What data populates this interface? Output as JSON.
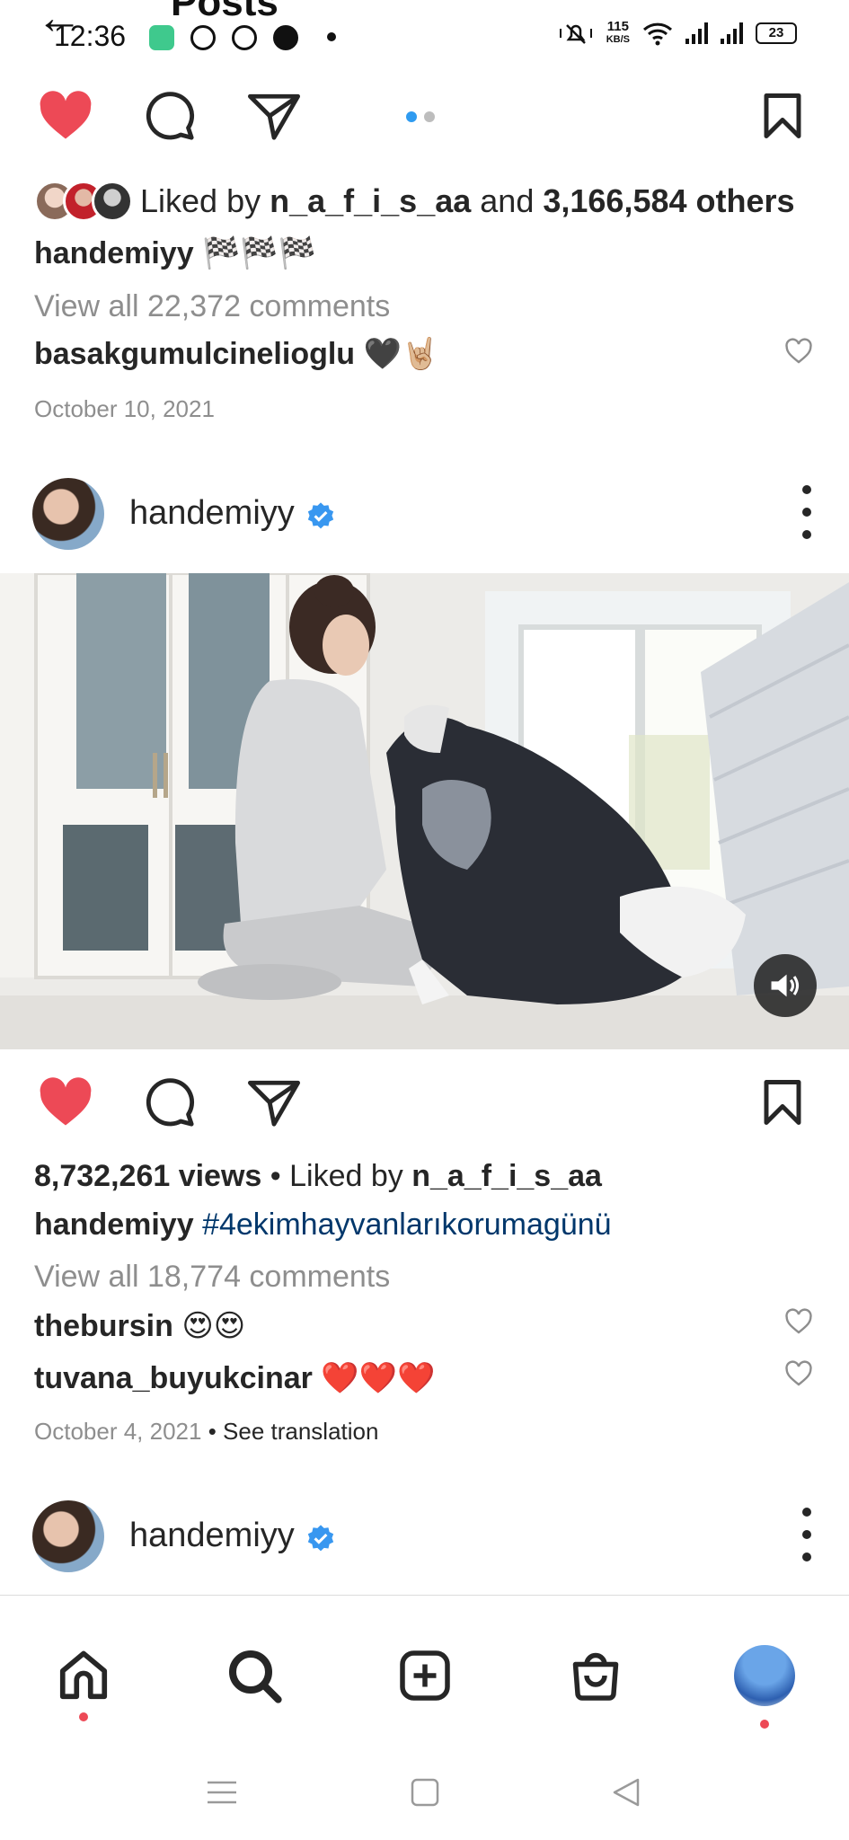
{
  "status_bar": {
    "time": "12:36",
    "network_speed_value": "115",
    "network_speed_unit": "KB/S",
    "battery": "23"
  },
  "header": {
    "back_icon": "arrow-left-icon",
    "title": "Posts"
  },
  "post1": {
    "icons": [
      "heart-filled-icon",
      "comment-icon",
      "share-icon",
      "bookmark-icon"
    ],
    "liked_prefix": "Liked by ",
    "liked_user": "n_a_f_i_s_aa",
    "liked_mid": " and ",
    "liked_count": "3,166,584 others",
    "caption_user": "handemiyy",
    "caption_text": " 🏁🏁🏁",
    "view_comments": "View all 22,372 comments",
    "comment_user": "basakgumulcinelioglu",
    "comment_text": " 🖤🤘🏼",
    "date": "October 10, 2021"
  },
  "post2": {
    "username": "handemiyy",
    "views": "8,732,261 views",
    "liked_prefix": " • Liked by ",
    "liked_user": "n_a_f_i_s_aa",
    "caption_user": "handemiyy",
    "caption_hashtag": " #4ekimhayvanlarıkorumagünü",
    "view_comments": "View all 18,774 comments",
    "comments": [
      {
        "user": "thebursin",
        "text": " 😍😍"
      },
      {
        "user": "tuvana_buyukcinar",
        "text": " ❤️❤️❤️"
      }
    ],
    "date": "October 4, 2021",
    "see_translation": " • See translation"
  },
  "post3": {
    "username": "handemiyy"
  },
  "bottom_nav": [
    "home-icon",
    "search-icon",
    "create-icon",
    "shop-icon",
    "profile-avatar"
  ],
  "colors": {
    "like_red": "#ed4956",
    "verified_blue": "#3897f0",
    "hashtag_blue": "#00376b",
    "muted": "#8e8e8e"
  }
}
